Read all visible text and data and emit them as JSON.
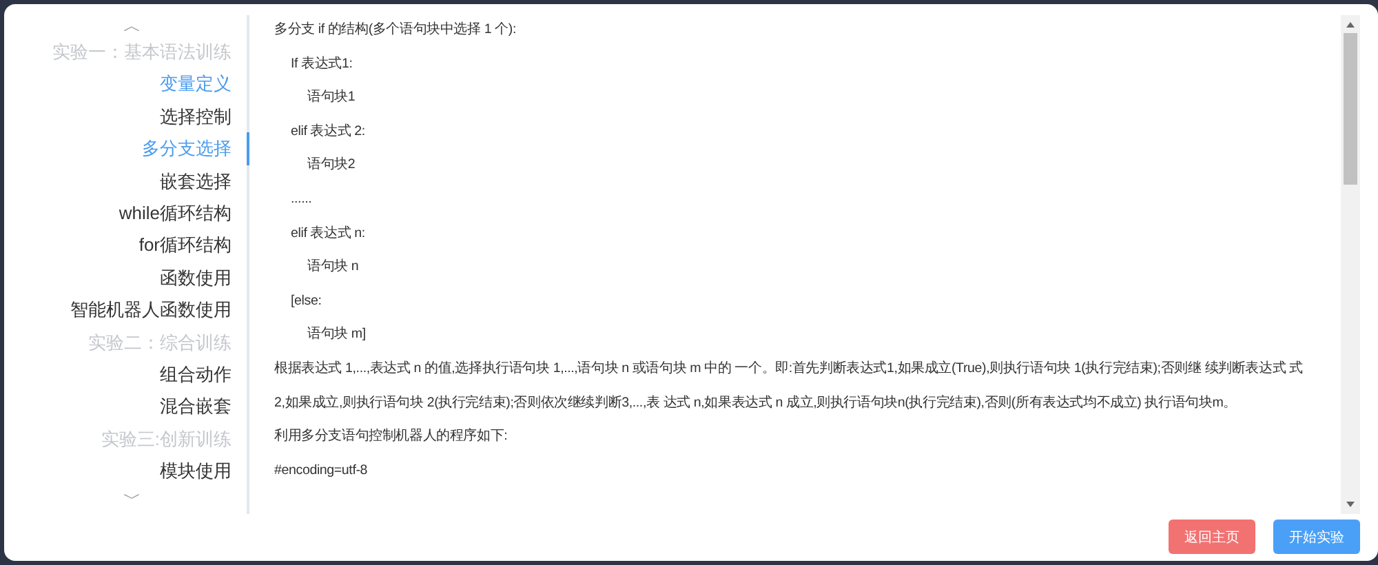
{
  "sidebar": {
    "scroll_up": "︿",
    "scroll_down": "﹀",
    "items": [
      {
        "kind": "header",
        "label": "实验一：基本语法训练"
      },
      {
        "kind": "item",
        "label": "变量定义",
        "selected": false,
        "highlighted": true
      },
      {
        "kind": "item",
        "label": "选择控制",
        "selected": false,
        "highlighted": false
      },
      {
        "kind": "item",
        "label": "多分支选择",
        "selected": true,
        "highlighted": true
      },
      {
        "kind": "item",
        "label": "嵌套选择",
        "selected": false,
        "highlighted": false
      },
      {
        "kind": "item",
        "label": "while循环结构",
        "selected": false,
        "highlighted": false
      },
      {
        "kind": "item",
        "label": "for循环结构",
        "selected": false,
        "highlighted": false
      },
      {
        "kind": "item",
        "label": "函数使用",
        "selected": false,
        "highlighted": false
      },
      {
        "kind": "item",
        "label": "智能机器人函数使用",
        "selected": false,
        "highlighted": false
      },
      {
        "kind": "header",
        "label": "实验二：综合训练"
      },
      {
        "kind": "item",
        "label": "组合动作",
        "selected": false,
        "highlighted": false
      },
      {
        "kind": "item",
        "label": "混合嵌套",
        "selected": false,
        "highlighted": false
      },
      {
        "kind": "header",
        "label": "实验三:创新训练"
      },
      {
        "kind": "item",
        "label": "模块使用",
        "selected": false,
        "highlighted": false
      }
    ]
  },
  "content": {
    "paragraphs": [
      {
        "text": "多分支 if 的结构(多个语句块中选择 1 个):",
        "children": [
          {
            "text": "If 表达式1:",
            "children": [
              {
                "text": "语句块1"
              }
            ]
          },
          {
            "text": "elif 表达式 2:",
            "children": [
              {
                "text": "语句块2"
              }
            ]
          },
          {
            "text": "......"
          },
          {
            "text": "elif 表达式 n:",
            "children": [
              {
                "text": "语句块 n"
              }
            ]
          },
          {
            "text": "[else:",
            "children": [
              {
                "text": "语句块 m]"
              }
            ]
          }
        ]
      },
      {
        "text": "根据表达式 1,...,表达式 n 的值,选择执行语句块 1,...,语句块 n 或语句块 m 中的 一个。即:首先判断表达式1,如果成立(True),则执行语句块 1(执行完结束);否则继 续判断表达式 式"
      },
      {
        "text": "2,如果成立,则执行语句块 2(执行完结束);否则依次继续判断3,...,表 达式 n,如果表达式 n 成立,则执行语句块n(执行完结束),否则(所有表达式均不成立) 执行语句块m。"
      },
      {
        "text": "利用多分支语句控制机器人的程序如下:"
      },
      {
        "text": "#encoding=utf-8"
      }
    ]
  },
  "buttons": [
    {
      "kind": "danger",
      "label": "返回主页"
    },
    {
      "kind": "primary",
      "label": "开始实验"
    }
  ]
}
